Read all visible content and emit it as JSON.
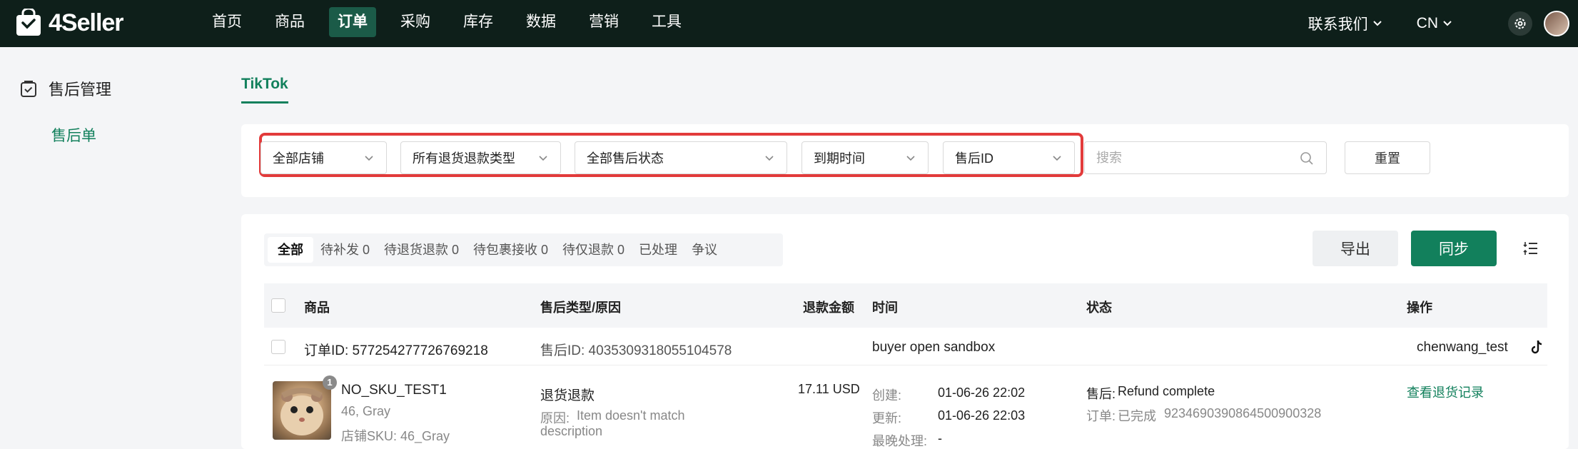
{
  "app": {
    "brand": "4Seller"
  },
  "nav": {
    "items": [
      {
        "label": "首页"
      },
      {
        "label": "商品"
      },
      {
        "label": "订单",
        "active": true
      },
      {
        "label": "采购"
      },
      {
        "label": "库存"
      },
      {
        "label": "数据"
      },
      {
        "label": "营销"
      },
      {
        "label": "工具"
      }
    ],
    "contact": "联系我们",
    "lang": "CN"
  },
  "sidebar": {
    "section": "售后管理",
    "item": "售后单"
  },
  "platform_tab": "TikTok",
  "filters": {
    "store": "全部店铺",
    "refund_type": "所有退货退款类型",
    "status": "全部售后状态",
    "time": "到期时间",
    "id_type": "售后ID",
    "search_placeholder": "搜索",
    "reset": "重置"
  },
  "status_tabs": [
    {
      "label": "全部",
      "active": true
    },
    {
      "label": "待补发 0"
    },
    {
      "label": "待退货退款 0"
    },
    {
      "label": "待包裹接收 0"
    },
    {
      "label": "待仅退款 0"
    },
    {
      "label": "已处理"
    },
    {
      "label": "争议"
    }
  ],
  "actions": {
    "export": "导出",
    "sync": "同步"
  },
  "table": {
    "headers": {
      "product": "商品",
      "type": "售后类型/原因",
      "amount": "退款金额",
      "time": "时间",
      "status": "状态",
      "action": "操作"
    },
    "order": {
      "order_id": "订单ID: 577254277726769218",
      "aftersale_id": "售后ID: 4035309318055104578",
      "note": "buyer open sandbox",
      "shop": "chenwang_test"
    },
    "product": {
      "badge": "1",
      "name": "NO_SKU_TEST1",
      "variant": "46, Gray",
      "store_sku": "店铺SKU: 46_Gray",
      "type": "退货退款",
      "reason_label": "原因:",
      "reason": "Item doesn't match",
      "reason2": "description",
      "amount": "17.11 USD",
      "created_label": "创建:",
      "created": "01-06-26 22:02",
      "updated_label": "更新:",
      "updated": "01-06-26 22:03",
      "deadline_label": "最晚处理:",
      "deadline": "-",
      "aftersale_status_label": "售后:",
      "aftersale_status": "Refund complete",
      "order_status_label": "订单:",
      "order_status": "已完成",
      "tracking": "9234690390864500900328",
      "action_link": "查看退货记录"
    }
  }
}
